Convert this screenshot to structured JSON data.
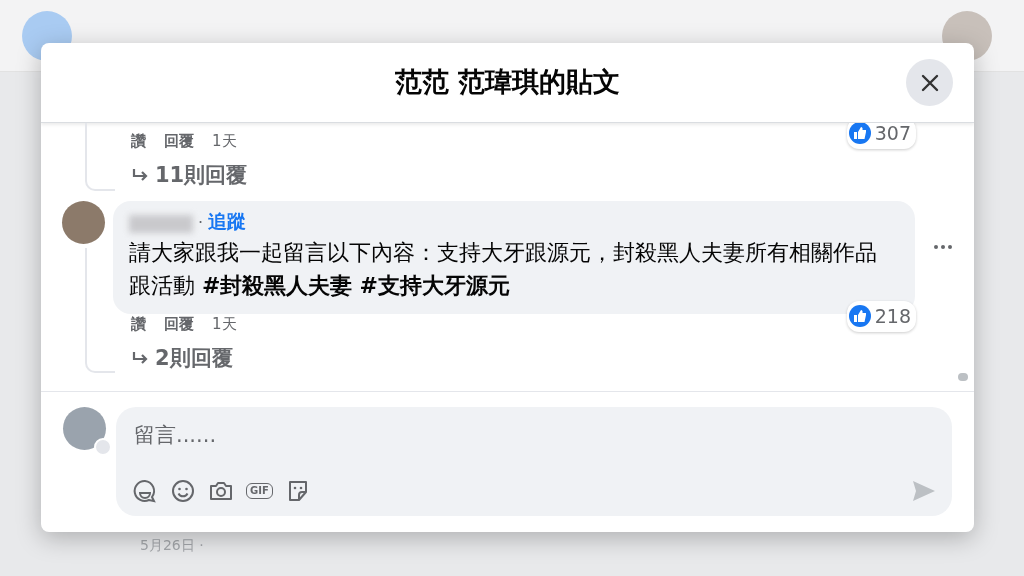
{
  "window": {
    "title": "范范 范瑋琪的貼文"
  },
  "comments": [
    {
      "kind": "cut",
      "actions": [
        "讚",
        "回覆"
      ],
      "time": "1天",
      "likes": "307",
      "replies": "11則回覆"
    },
    {
      "kind": "full",
      "separator": "·",
      "follow": "追蹤",
      "text": "請大家跟我一起留言以下內容：支持大牙跟源元，封殺黑人夫妻所有相關作品跟活動 **#封殺黑人夫妻** **#支持大牙源元**",
      "actions": [
        "讚",
        "回覆"
      ],
      "time": "1天",
      "likes": "218",
      "replies": "2則回覆"
    }
  ],
  "composer": {
    "placeholder": "留言......",
    "gif_label": "GIF"
  },
  "background": {
    "date": "5月26日 ·"
  }
}
